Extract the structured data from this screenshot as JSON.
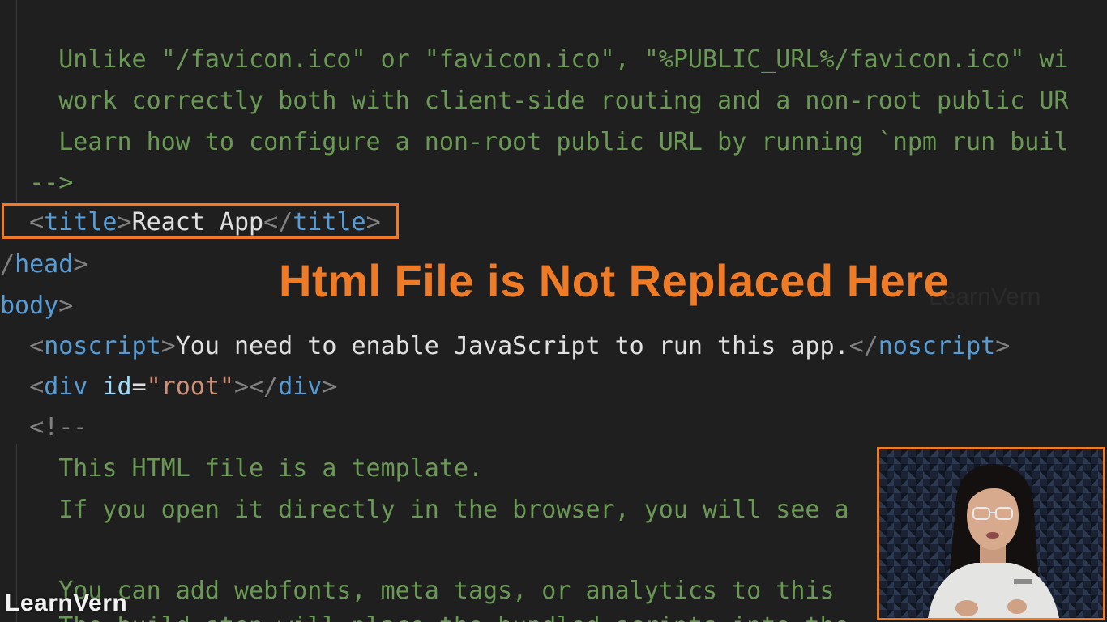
{
  "editor": {
    "lines": [
      {
        "id": "l1",
        "text": "    Unlike \"/favicon.ico\" or \"favicon.ico\", \"%PUBLIC_URL%/favicon.ico\" wi"
      },
      {
        "id": "l2",
        "text": "    work correctly both with client-side routing and a non-root public UR"
      },
      {
        "id": "l3",
        "text": "    Learn how to configure a non-root public URL by running `npm run buil"
      },
      {
        "id": "l4",
        "text": "  -->"
      },
      {
        "id": "l5",
        "tag": "title",
        "text": "React App"
      },
      {
        "id": "l6",
        "tag": "head"
      },
      {
        "id": "l7",
        "tag": "body"
      },
      {
        "id": "l8",
        "tag": "noscript",
        "text": "You need to enable JavaScript to run this app."
      },
      {
        "id": "l9",
        "tag": "div",
        "attr": "id",
        "value": "\"root\""
      },
      {
        "id": "l10",
        "text": "  <!--"
      },
      {
        "id": "l11",
        "text": "    This HTML file is a template."
      },
      {
        "id": "l12",
        "text": "    If you open it directly in the browser, you will see a"
      },
      {
        "id": "l13",
        "text": ""
      },
      {
        "id": "l14",
        "text": "    You can add webfonts, meta tags, or analytics to this"
      },
      {
        "id": "l15",
        "text": "    The build step will place the bundled scripts into the"
      }
    ]
  },
  "overlay": {
    "title": "Html File is Not Replaced Here",
    "ghost": "LearnVern"
  },
  "brand": {
    "name": "LearnVern"
  },
  "webcam": {
    "description_icon": "presenter-webcam"
  },
  "colors": {
    "accent": "#f07b26",
    "comment": "#6a9955",
    "tag": "#569cd6",
    "attr": "#9cdcfe",
    "string": "#ce9178",
    "background": "#1f1f1f"
  }
}
